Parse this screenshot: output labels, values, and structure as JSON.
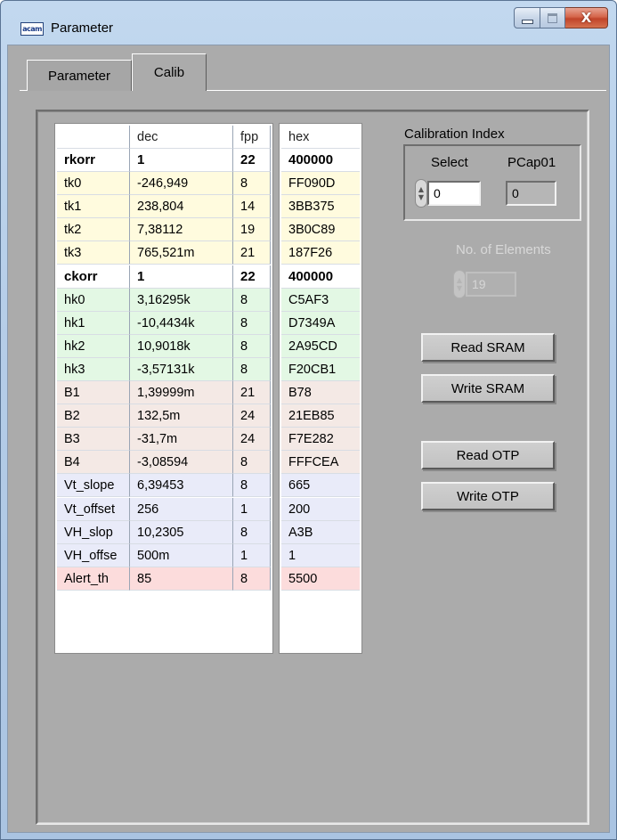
{
  "window": {
    "title": "Parameter",
    "app_icon_text": "acam",
    "buttons": {
      "minimize": "minimize",
      "maximize": "maximize",
      "close": "X"
    }
  },
  "tabs": [
    {
      "label": "Parameter",
      "selected": false
    },
    {
      "label": "Calib",
      "selected": true
    }
  ],
  "table": {
    "headers": {
      "name": "",
      "dec": "dec",
      "fpp": "fpp",
      "hex": "hex"
    },
    "rows": [
      {
        "name": "rkorr",
        "dec": "1",
        "fpp": "22",
        "hex": "400000",
        "style": "bold"
      },
      {
        "name": "tk0",
        "dec": "-246,949",
        "fpp": "8",
        "hex": "FF090D",
        "style": "y"
      },
      {
        "name": "tk1",
        "dec": "238,804",
        "fpp": "14",
        "hex": "3BB375",
        "style": "y"
      },
      {
        "name": "tk2",
        "dec": "7,38112",
        "fpp": "19",
        "hex": "3B0C89",
        "style": "y"
      },
      {
        "name": "tk3",
        "dec": "765,521m",
        "fpp": "21",
        "hex": "187F26",
        "style": "y"
      },
      {
        "name": "ckorr",
        "dec": "1",
        "fpp": "22",
        "hex": "400000",
        "style": "bold"
      },
      {
        "name": "hk0",
        "dec": "3,16295k",
        "fpp": "8",
        "hex": "C5AF3",
        "style": "g"
      },
      {
        "name": "hk1",
        "dec": "-10,4434k",
        "fpp": "8",
        "hex": "D7349A",
        "style": "g"
      },
      {
        "name": "hk2",
        "dec": "10,9018k",
        "fpp": "8",
        "hex": "2A95CD",
        "style": "g"
      },
      {
        "name": "hk3",
        "dec": "-3,57131k",
        "fpp": "8",
        "hex": "F20CB1",
        "style": "g"
      },
      {
        "name": "B1",
        "dec": "1,39999m",
        "fpp": "21",
        "hex": "B78",
        "style": "pk"
      },
      {
        "name": "B2",
        "dec": "132,5m",
        "fpp": "24",
        "hex": "21EB85",
        "style": "pk"
      },
      {
        "name": "B3",
        "dec": "-31,7m",
        "fpp": "24",
        "hex": "F7E282",
        "style": "pk"
      },
      {
        "name": "B4",
        "dec": "-3,08594",
        "fpp": "8",
        "hex": "FFFCEA",
        "style": "pk"
      },
      {
        "name": "Vt_slope",
        "dec": "6,39453",
        "fpp": "8",
        "hex": "665",
        "style": "lv"
      },
      {
        "name": "Vt_offset",
        "dec": "256",
        "fpp": "1",
        "hex": "200",
        "style": "lv"
      },
      {
        "name": "VH_slop",
        "dec": "10,2305",
        "fpp": "8",
        "hex": "A3B",
        "style": "lv"
      },
      {
        "name": "VH_offse",
        "dec": "500m",
        "fpp": "1",
        "hex": "1",
        "style": "lv"
      },
      {
        "name": "Alert_th",
        "dec": "85",
        "fpp": "8",
        "hex": "5500",
        "style": "rd"
      }
    ]
  },
  "calibration": {
    "group_label": "Calibration Index",
    "select_label": "Select",
    "select_value": "0",
    "pcap_label": "PCap01",
    "pcap_value": "0",
    "elements_label": "No. of Elements",
    "elements_value": "19"
  },
  "actions": {
    "read_sram": "Read SRAM",
    "write_sram": "Write SRAM",
    "read_otp": "Read OTP",
    "write_otp": "Write OTP"
  },
  "colors": {
    "yellow_row": "#fffbde",
    "green_row": "#e3f8e4",
    "pink_row": "#f4e9e5",
    "lavender_row": "#e9ebf9",
    "red_row": "#fcdcdc",
    "panel_grey": "#ababab"
  }
}
